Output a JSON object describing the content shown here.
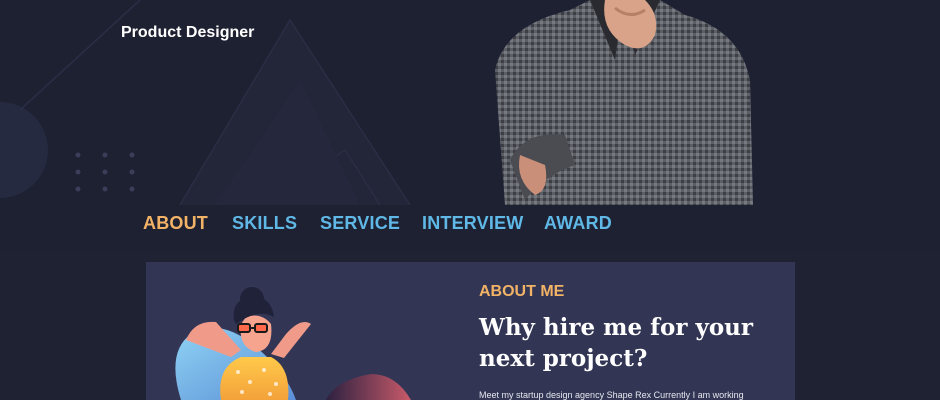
{
  "hero": {
    "role": "Product Designer"
  },
  "nav": {
    "items": [
      {
        "label": "ABOUT",
        "active": true
      },
      {
        "label": "SKILLS",
        "active": false
      },
      {
        "label": "SERVICE",
        "active": false
      },
      {
        "label": "INTERVIEW",
        "active": false
      },
      {
        "label": "AWARD",
        "active": false
      }
    ]
  },
  "about": {
    "label": "ABOUT ME",
    "title": "Why hire me for your next project?",
    "text": "Meet my startup design agency Shape Rex Currently I am working"
  },
  "colors": {
    "background": "#1e2132",
    "card": "#323554",
    "accent_orange": "#f3b366",
    "nav_blue": "#5fb8e6"
  }
}
